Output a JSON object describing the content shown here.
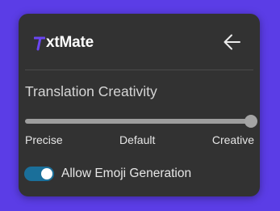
{
  "app": {
    "logo_text": "xtMate",
    "logo_letter": "T",
    "logo_accent_color": "#6b46f2"
  },
  "header": {
    "back_icon": "arrow-left-icon"
  },
  "creativity": {
    "title": "Translation Creativity",
    "value": 1.0,
    "labels": {
      "min": "Precise",
      "mid": "Default",
      "max": "Creative"
    }
  },
  "emoji_toggle": {
    "label": "Allow Emoji Generation",
    "checked": true,
    "on_color": "#1a6f9a"
  },
  "colors": {
    "background": "#5b3de6",
    "panel": "#323232"
  }
}
